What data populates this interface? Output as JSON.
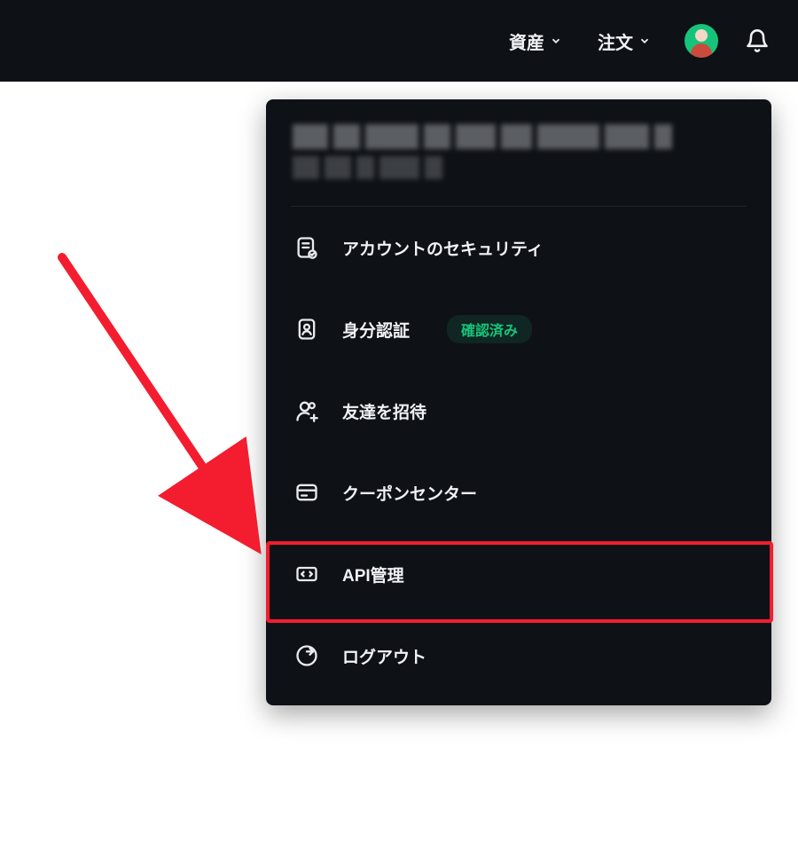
{
  "nav": {
    "assets": "資産",
    "orders": "注文"
  },
  "menu": {
    "security": "アカウントのセキュリティ",
    "identity": "身分認証",
    "identity_badge": "確認済み",
    "invite": "友達を招待",
    "coupon": "クーポンセンター",
    "api": "API管理",
    "logout": "ログアウト"
  }
}
